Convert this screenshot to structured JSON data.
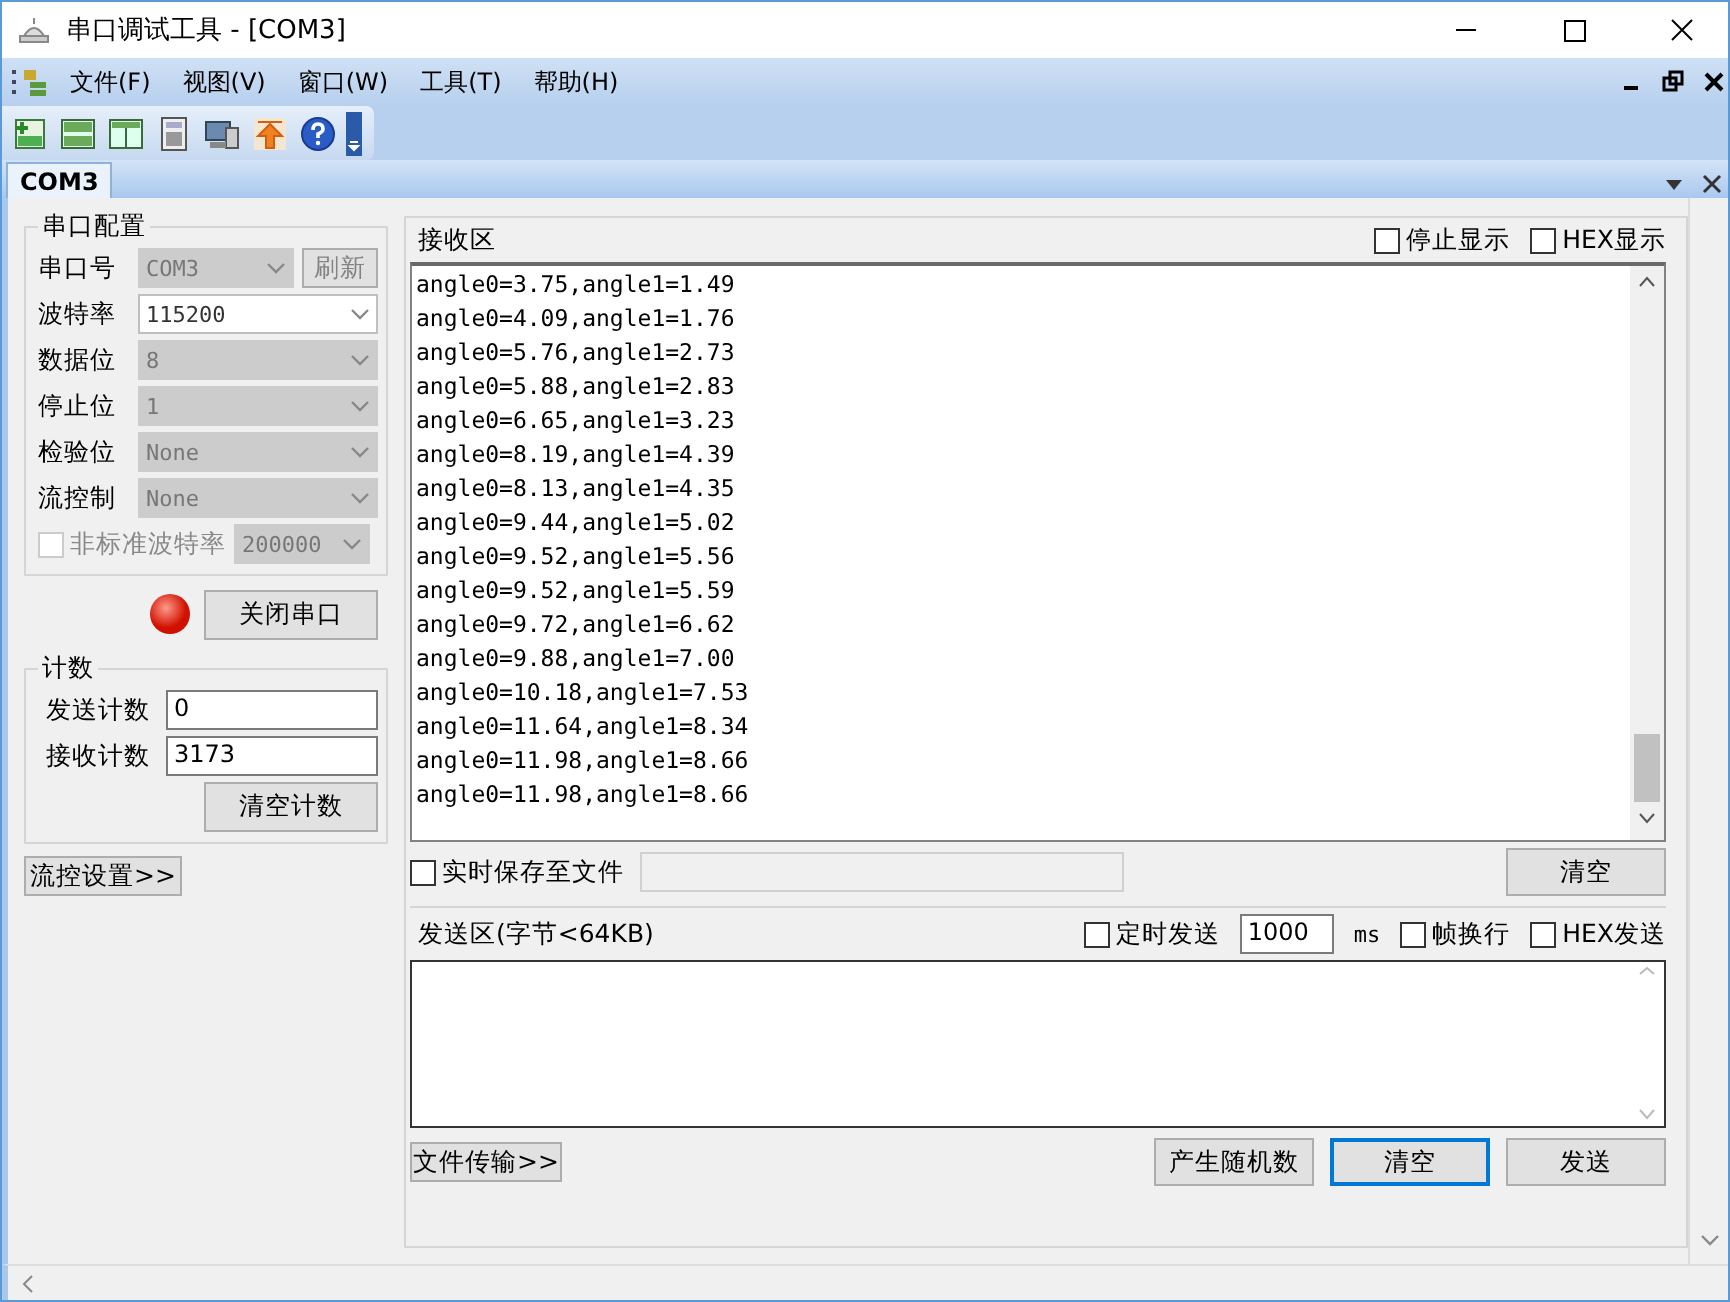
{
  "window": {
    "title": "串口调试工具 - [COM3]"
  },
  "menu": [
    "文件(F)",
    "视图(V)",
    "窗口(W)",
    "工具(T)",
    "帮助(H)"
  ],
  "tabs": [
    {
      "label": "COM3",
      "selected": true
    }
  ],
  "config": {
    "title": "串口配置",
    "fields": [
      {
        "label": "串口号",
        "value": "COM3",
        "disabled": true,
        "button": "刷新"
      },
      {
        "label": "波特率",
        "value": "115200",
        "disabled": false
      },
      {
        "label": "数据位",
        "value": "8",
        "disabled": true
      },
      {
        "label": "停止位",
        "value": "1",
        "disabled": true
      },
      {
        "label": "检验位",
        "value": "None",
        "disabled": true
      },
      {
        "label": "流控制",
        "value": "None",
        "disabled": true
      }
    ],
    "custom_baud": {
      "label": "非标准波特率",
      "checked": false,
      "disabled": true,
      "value": "200000"
    },
    "port_open": true,
    "toggle_button": "关闭串口"
  },
  "counts": {
    "title": "计数",
    "rows": [
      {
        "label": "发送计数",
        "value": "0"
      },
      {
        "label": "接收计数",
        "value": "3173"
      }
    ],
    "clear_button": "清空计数"
  },
  "flow_button": "流控设置>>",
  "receive": {
    "title": "接收区",
    "options": [
      {
        "label": "停止显示",
        "checked": false
      },
      {
        "label": "HEX显示",
        "checked": false
      }
    ],
    "lines": [
      "angle0=3.75,angle1=1.49",
      "angle0=4.09,angle1=1.76",
      "angle0=5.76,angle1=2.73",
      "angle0=5.88,angle1=2.83",
      "angle0=6.65,angle1=3.23",
      "angle0=8.19,angle1=4.39",
      "angle0=8.13,angle1=4.35",
      "angle0=9.44,angle1=5.02",
      "angle0=9.52,angle1=5.56",
      "angle0=9.52,angle1=5.59",
      "angle0=9.72,angle1=6.62",
      "angle0=9.88,angle1=7.00",
      "angle0=10.18,angle1=7.53",
      "angle0=11.64,angle1=8.34",
      "angle0=11.98,angle1=8.66",
      "angle0=11.98,angle1=8.66"
    ],
    "save": {
      "label": "实时保存至文件",
      "checked": false
    },
    "clear_button": "清空"
  },
  "send": {
    "title": "发送区(字节<64KB)",
    "timer": {
      "label": "定时发送",
      "checked": false,
      "value": "1000",
      "unit": "ms"
    },
    "options": [
      {
        "label": "帧换行",
        "checked": false
      },
      {
        "label": "HEX发送",
        "checked": false
      }
    ],
    "file_button": "文件传输>>",
    "buttons": [
      {
        "label": "产生随机数",
        "focused": false
      },
      {
        "label": "清空",
        "focused": true
      },
      {
        "label": "发送",
        "focused": false
      }
    ]
  }
}
